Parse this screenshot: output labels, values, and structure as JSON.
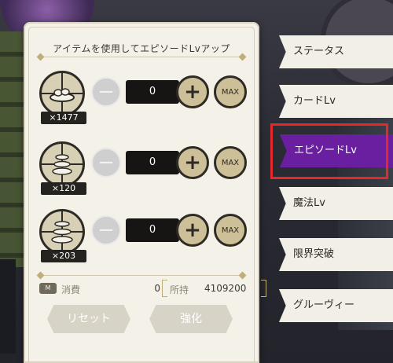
{
  "panel": {
    "title": "アイテムを使用してエピソードLvアップ",
    "items": [
      {
        "count": "×1477",
        "quantity": "0",
        "minus_label": "−",
        "plus_label": "+",
        "max_label": "MAX"
      },
      {
        "count": "×120",
        "quantity": "0",
        "minus_label": "−",
        "plus_label": "+",
        "max_label": "MAX"
      },
      {
        "count": "×203",
        "quantity": "0",
        "minus_label": "−",
        "plus_label": "+",
        "max_label": "MAX"
      }
    ],
    "cost": {
      "icon_label": "M",
      "consume_label": "消費",
      "consume_value": "0",
      "owned_label": "所持",
      "owned_value": "4109200"
    },
    "reset_label": "リセット",
    "enhance_label": "強化"
  },
  "tabs": [
    {
      "label": "ステータス"
    },
    {
      "label": "カードLv"
    },
    {
      "label": "エピソードLv"
    },
    {
      "label": "魔法Lv"
    },
    {
      "label": "限界突破"
    },
    {
      "label": "グルーヴィー"
    }
  ],
  "active_tab": "エピソードLv",
  "colors": {
    "active_tab": "#6a1fa0",
    "highlight": "#e5282a",
    "panel_bg": "#f4f1e8"
  }
}
